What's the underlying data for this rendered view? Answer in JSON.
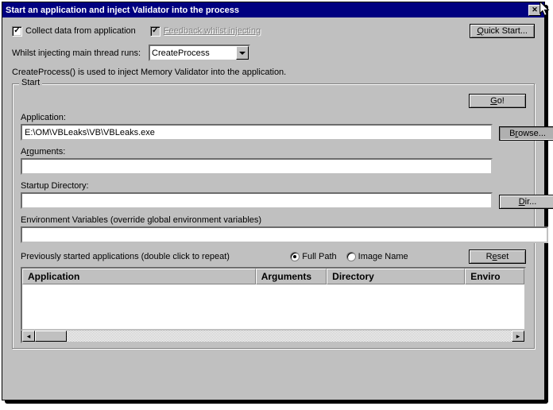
{
  "title": "Start an application and inject Validator into the process",
  "checkboxes": {
    "collect": {
      "label": "Collect data from application",
      "checked": true,
      "enabled": true
    },
    "feedback": {
      "label": "Feedback whilst injecting",
      "checked": true,
      "enabled": false
    }
  },
  "quick_start_label": "Quick Start...",
  "thread_row": {
    "label": "Whilst injecting main thread runs:",
    "selected": "CreateProcess"
  },
  "info_text": "CreateProcess() is used to inject Memory Validator into the application.",
  "group_legend": "Start",
  "go_label": "Go!",
  "application": {
    "label": "Application:",
    "value": "E:\\OM\\VBLeaks\\VB\\VBLeaks.exe",
    "browse_label": "Browse..."
  },
  "arguments": {
    "label": "Arguments:",
    "value": ""
  },
  "startup_dir": {
    "label": "Startup Directory:",
    "value": "",
    "dir_label": "Dir..."
  },
  "env_vars": {
    "label": "Environment Variables (override global environment variables)",
    "value": ""
  },
  "prev_label": "Previously started applications (double click to repeat)",
  "radios": {
    "full_path": "Full Path",
    "image_name": "Image Name",
    "selected": "full_path"
  },
  "reset_label": "Reset",
  "columns": {
    "application": "Application",
    "arguments": "Arguments",
    "directory": "Directory",
    "environment": "Environment"
  }
}
